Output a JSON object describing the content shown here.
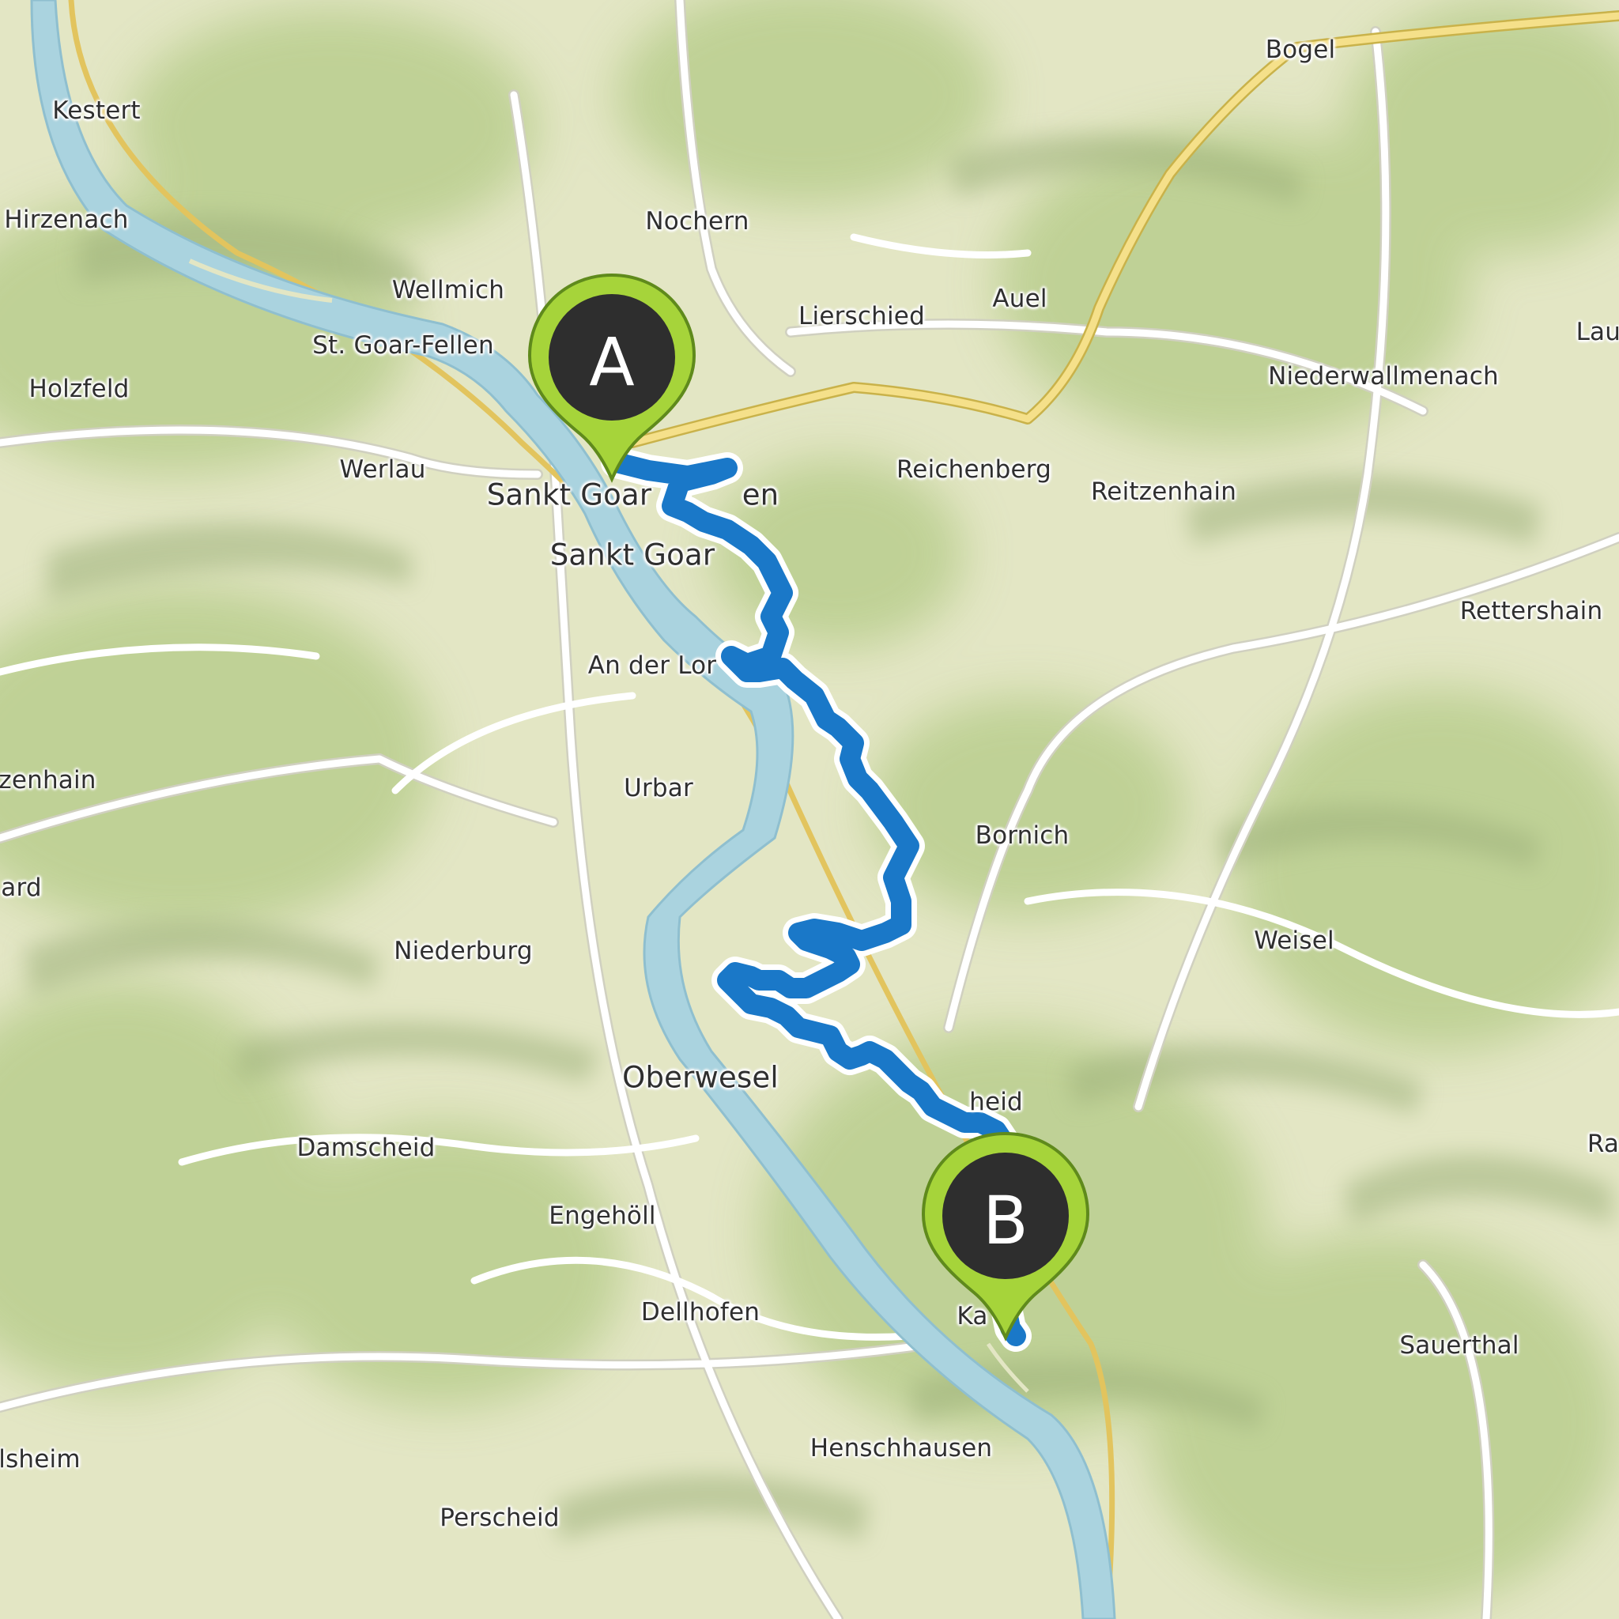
{
  "colors": {
    "land": "#e3e6c4",
    "forest": "#b9ce8e",
    "shade": "#9fb27c",
    "water": "#aad3df",
    "road": "#ffffff",
    "main_road": "#f5e08a",
    "route": "#1a78c8",
    "marker_fill": "#a6d43a",
    "marker_badge": "#2e2e2e"
  },
  "route": {
    "from": "A",
    "to": "B"
  },
  "markers": [
    {
      "id": "A",
      "label": "A",
      "icon": "map-pin-icon"
    },
    {
      "id": "B",
      "label": "B",
      "icon": "map-pin-icon"
    }
  ],
  "places": [
    {
      "name": "Kestert"
    },
    {
      "name": "Hirzenach"
    },
    {
      "name": "Nochern"
    },
    {
      "name": "Bogel"
    },
    {
      "name": "Wellmich"
    },
    {
      "name": "Lierschied"
    },
    {
      "name": "Auel"
    },
    {
      "name": "St. Goar-Fellen"
    },
    {
      "name": "Laut"
    },
    {
      "name": "Holzfeld"
    },
    {
      "name": "Niederwallmenach"
    },
    {
      "name": "Werlau"
    },
    {
      "name": "Reichenberg"
    },
    {
      "name": "Sankt Goar"
    },
    {
      "name": "en"
    },
    {
      "name": "Reitzenhain"
    },
    {
      "name": "Sankt Goar"
    },
    {
      "name": "Rettershain"
    },
    {
      "name": "An der Lor"
    },
    {
      "name": "zenhain"
    },
    {
      "name": "Urbar"
    },
    {
      "name": "Bornich"
    },
    {
      "name": "ard"
    },
    {
      "name": "Niederburg"
    },
    {
      "name": "Weisel"
    },
    {
      "name": "Oberwesel"
    },
    {
      "name": "heid"
    },
    {
      "name": "Damscheid"
    },
    {
      "name": "Ra"
    },
    {
      "name": "Engehöll"
    },
    {
      "name": "Dellhofen"
    },
    {
      "name": "Ka"
    },
    {
      "name": "Sauerthal"
    },
    {
      "name": "Henschhausen"
    },
    {
      "name": "lsheim"
    },
    {
      "name": "Perscheid"
    }
  ]
}
